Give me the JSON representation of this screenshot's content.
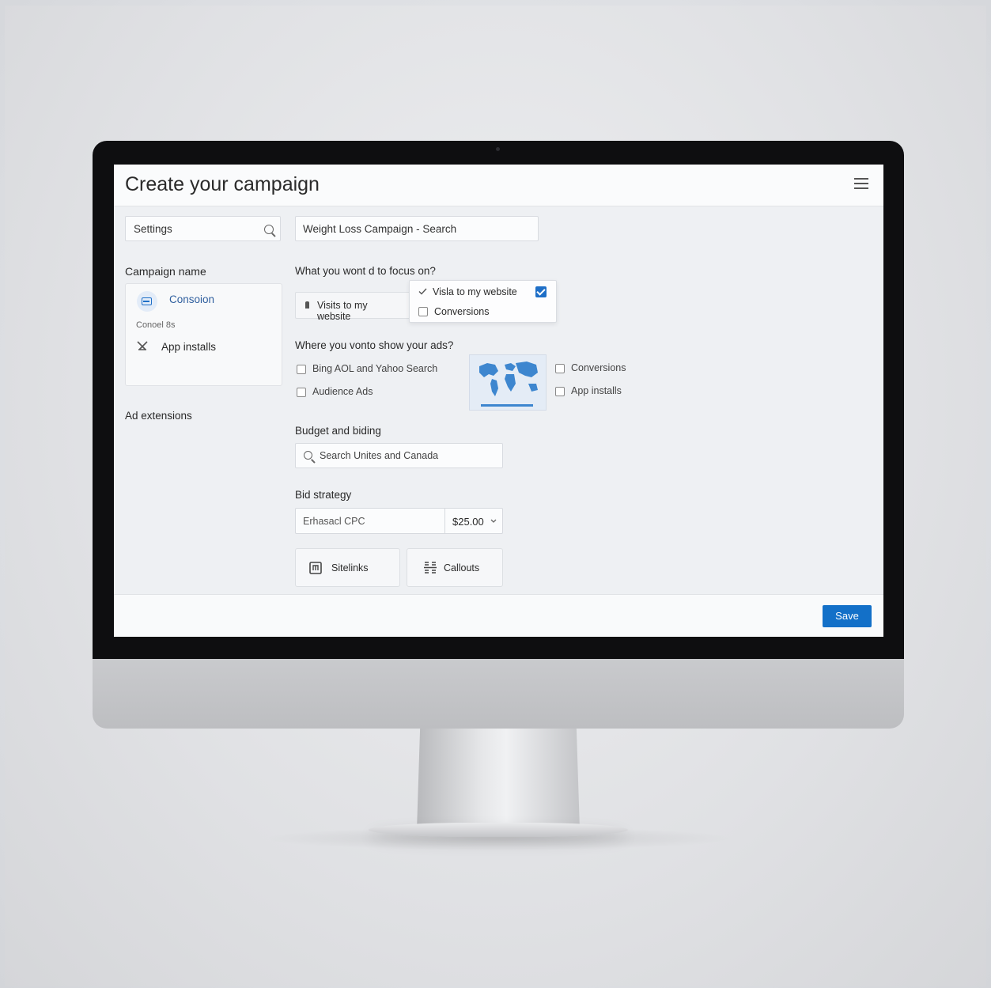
{
  "header": {
    "title": "Create your campaign"
  },
  "sidebar": {
    "search_value": "Settings",
    "campaign_name_label": "Campaign name",
    "card": {
      "item_1": "Consoion",
      "subheading": "Conoel 8s",
      "item_2": "App installs"
    },
    "ad_extensions_label": "Ad extensions"
  },
  "main": {
    "campaign_name_value": "Weight Loss Campaign - Search",
    "focus_question": "What you wont d to focus on?",
    "focus_selected": "Visits to my website",
    "focus_dropdown": {
      "option_1": "Visla to my website",
      "option_2": "Conversions"
    },
    "where_question": "Where you vonto show your ads?",
    "networks": [
      "Bing AOL and Yahoo Search",
      "Audience Ads"
    ],
    "goals": [
      "Conversions",
      "App installs"
    ],
    "budget_label": "Budget and biding",
    "location_search_value": "Search Unites and Canada",
    "bid_strategy_label": "Bid strategy",
    "bid_strategy_value": "Erhasacl CPC",
    "bid_amount": "$25.00",
    "sitelinks_label": "Sitelinks",
    "callouts_label": "Callouts"
  },
  "footer": {
    "save_label": "Save"
  },
  "colors": {
    "accent": "#1370c8",
    "map": "#3d86cf"
  },
  "icons": [
    "search-icon",
    "menu-icon",
    "conversion-icon",
    "pin-icon",
    "app-install-icon",
    "world-map-icon",
    "sitelinks-icon",
    "callouts-icon"
  ]
}
